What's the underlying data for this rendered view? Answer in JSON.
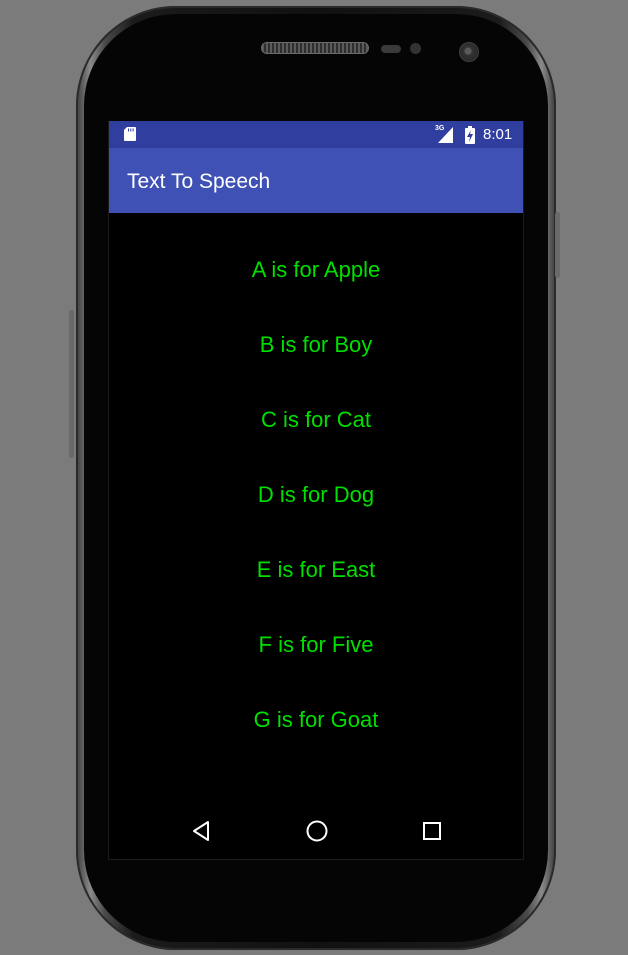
{
  "status_bar": {
    "time": "8:01",
    "network_type": "3G",
    "icons": [
      "sd-card-icon",
      "signal-icon",
      "battery-charging-icon"
    ]
  },
  "app_bar": {
    "title": "Text To Speech"
  },
  "list": {
    "items": [
      "A is for Apple",
      "B is for Boy",
      "C is for Cat",
      "D is for Dog",
      "E is for East",
      "F is for Five",
      "G is for Goat"
    ]
  },
  "nav_bar": {
    "icons": [
      "back-icon",
      "home-icon",
      "recents-icon"
    ]
  },
  "colors": {
    "status_bar": "#303f9f",
    "app_bar": "#3f51b5",
    "list_text": "#00e000",
    "screen_background": "#000000"
  }
}
